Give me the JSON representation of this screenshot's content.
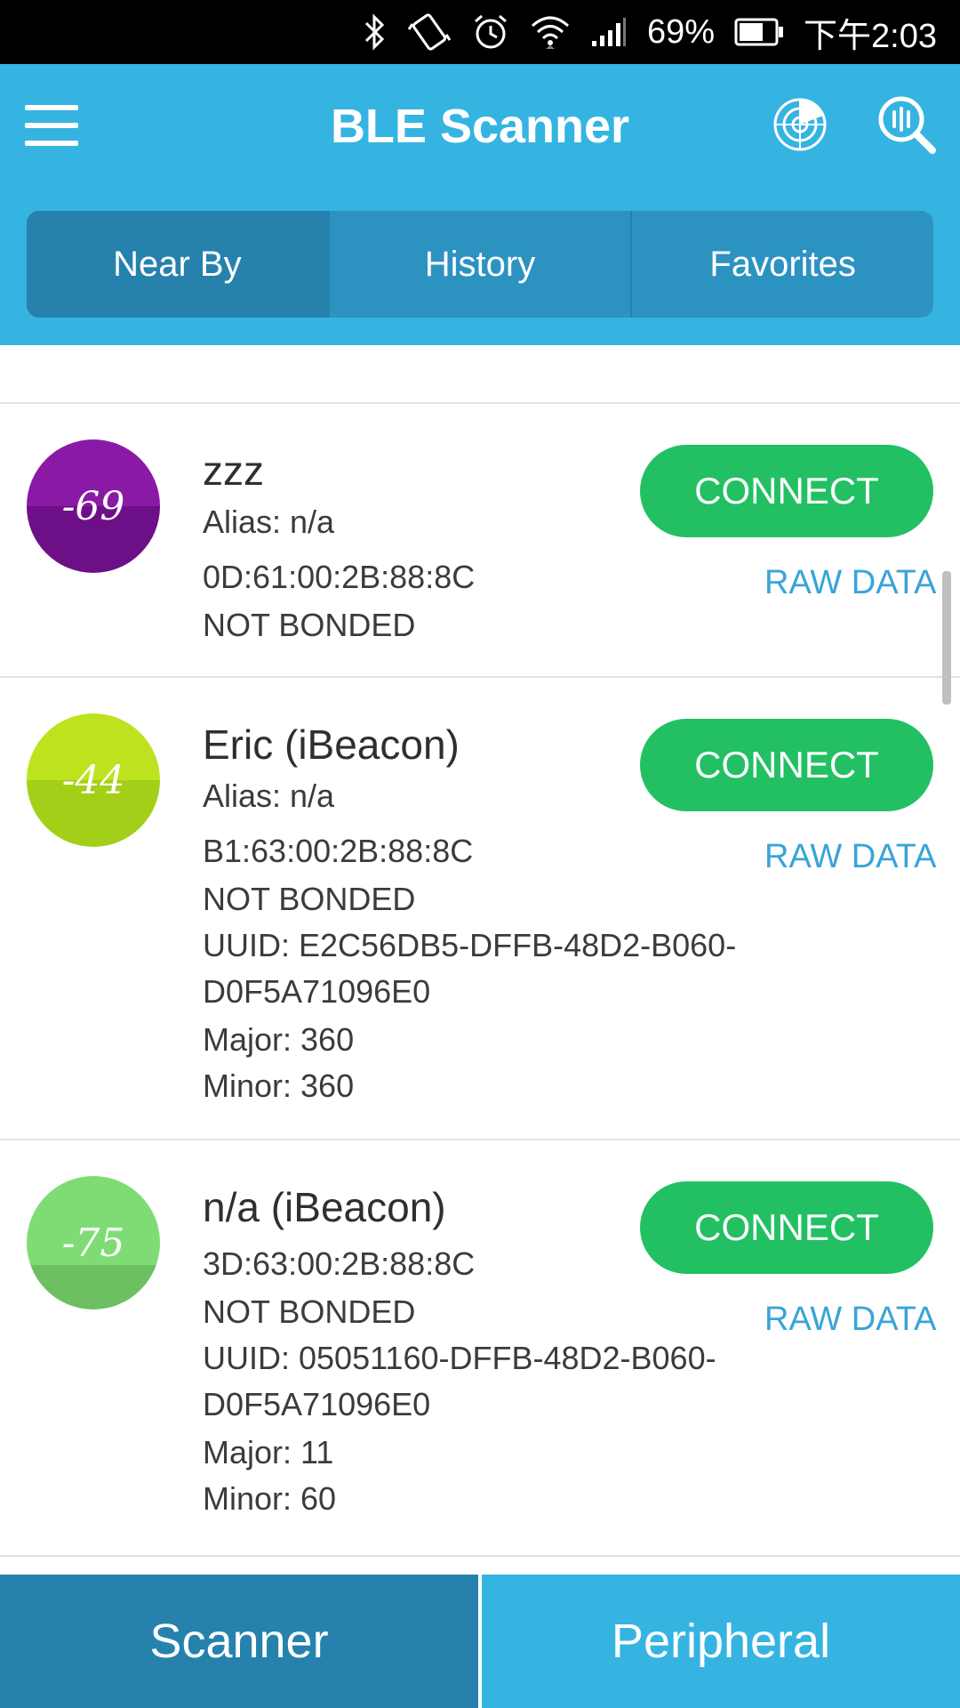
{
  "status_bar": {
    "battery": "69%",
    "time": "下午2:03",
    "icons": [
      "bluetooth-icon",
      "vibrate-icon",
      "alarm-icon",
      "wifi-icon",
      "signal-icon",
      "battery-icon"
    ]
  },
  "app_bar": {
    "title": "BLE Scanner",
    "menu_icon": "hamburger-menu-icon",
    "radar_icon": "radar-icon",
    "search_icon": "search-icon"
  },
  "tabs": [
    {
      "label": "Near By",
      "active": true
    },
    {
      "label": "History",
      "active": false
    },
    {
      "label": "Favorites",
      "active": false
    }
  ],
  "devices": [
    {
      "rssi": "-69",
      "name": "zzz",
      "alias": "Alias: n/a",
      "address": "0D:61:00:2B:88:8C",
      "bond": "NOT BONDED",
      "connect_label": "CONNECT",
      "raw_label": "RAW DATA",
      "color_top": "#8a1aa6",
      "color_bottom": "#6d0f86"
    },
    {
      "rssi": "-44",
      "name": "Eric (iBeacon)",
      "alias": "Alias: n/a",
      "address": "B1:63:00:2B:88:8C",
      "bond": "NOT BONDED",
      "uuid_1": "UUID: E2C56DB5-DFFB-48D2-B060-",
      "uuid_2": "D0F5A71096E0",
      "major": "Major: 360",
      "minor": "Minor: 360",
      "connect_label": "CONNECT",
      "raw_label": "RAW DATA",
      "color_top": "#bde31e",
      "color_bottom": "#a4cf18"
    },
    {
      "rssi": "-75",
      "name": "n/a (iBeacon)",
      "address": "3D:63:00:2B:88:8C",
      "bond": "NOT BONDED",
      "uuid_1": "UUID: 05051160-DFFB-48D2-B060-",
      "uuid_2": "D0F5A71096E0",
      "major": "Major: 11",
      "minor": "Minor: 60",
      "connect_label": "CONNECT",
      "raw_label": "RAW DATA",
      "color_top": "#7fdc74",
      "color_bottom": "#6cc062"
    }
  ],
  "bottom_nav": [
    {
      "label": "Scanner",
      "active": true
    },
    {
      "label": "Peripheral",
      "active": false
    }
  ],
  "colors": {
    "primary": "#35b4e2",
    "tab_bg": "#2c93c1",
    "tab_active": "#2682ad",
    "connect": "#22c063",
    "raw_data": "#39a4d8",
    "bottom_active": "#2682ad"
  }
}
